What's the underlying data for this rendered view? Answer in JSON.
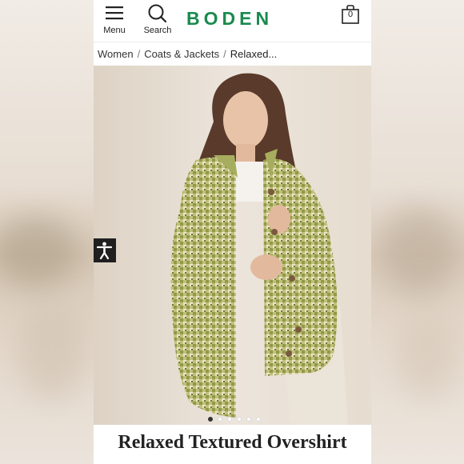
{
  "header": {
    "menu_label": "Menu",
    "search_label": "Search",
    "brand": "BODEN",
    "bag_count": "0"
  },
  "breadcrumb": {
    "items": [
      "Women",
      "Coats & Jackets",
      "Relaxed..."
    ],
    "separator": "/"
  },
  "carousel": {
    "slides": 6,
    "active_index": 0
  },
  "product": {
    "title": "Relaxed Textured Overshirt"
  },
  "colors": {
    "brand": "#1a8a4e",
    "accessibility_button": "#1f1f1f",
    "jacket": "#b8b865"
  },
  "icons": [
    "hamburger-menu-icon",
    "search-icon",
    "shopping-bag-icon",
    "accessibility-icon"
  ]
}
